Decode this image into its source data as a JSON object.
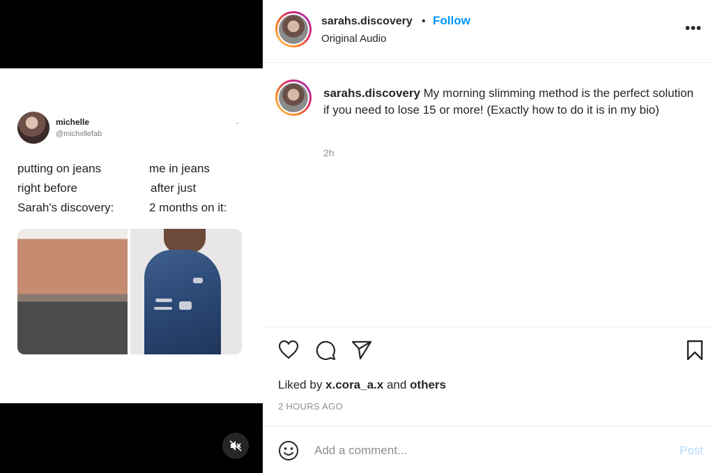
{
  "tweet": {
    "name": "michelle",
    "handle": "@michxllefab",
    "chevron": "⌄",
    "left_lines": [
      "putting on jeans",
      "right before",
      "Sarah's discovery:"
    ],
    "right_lines": [
      "me in jeans",
      "after just",
      "2 months on it:"
    ]
  },
  "header": {
    "username": "sarahs.discovery",
    "separator": "•",
    "follow_label": "Follow",
    "audio": "Original Audio",
    "more": "•••"
  },
  "caption": {
    "username": "sarahs.discovery",
    "text": " My morning slimming method is the perfect solution if you need to lose 15 or more! (Exactly how to do it is in my bio)",
    "time": "2h"
  },
  "likes": {
    "prefix": "Liked by ",
    "user": "x.cora_a.x",
    "middle": " and ",
    "others": "others"
  },
  "timestamp": "2 HOURS AGO",
  "comment": {
    "placeholder": "Add a comment...",
    "post_label": "Post"
  },
  "colors": {
    "follow": "#0095f6",
    "post_disabled": "#b3dbff",
    "muted_text": "#8e8e8e"
  },
  "icons": [
    "heart-icon",
    "comment-icon",
    "share-icon",
    "bookmark-icon",
    "emoji-icon",
    "mute-icon",
    "more-icon"
  ]
}
